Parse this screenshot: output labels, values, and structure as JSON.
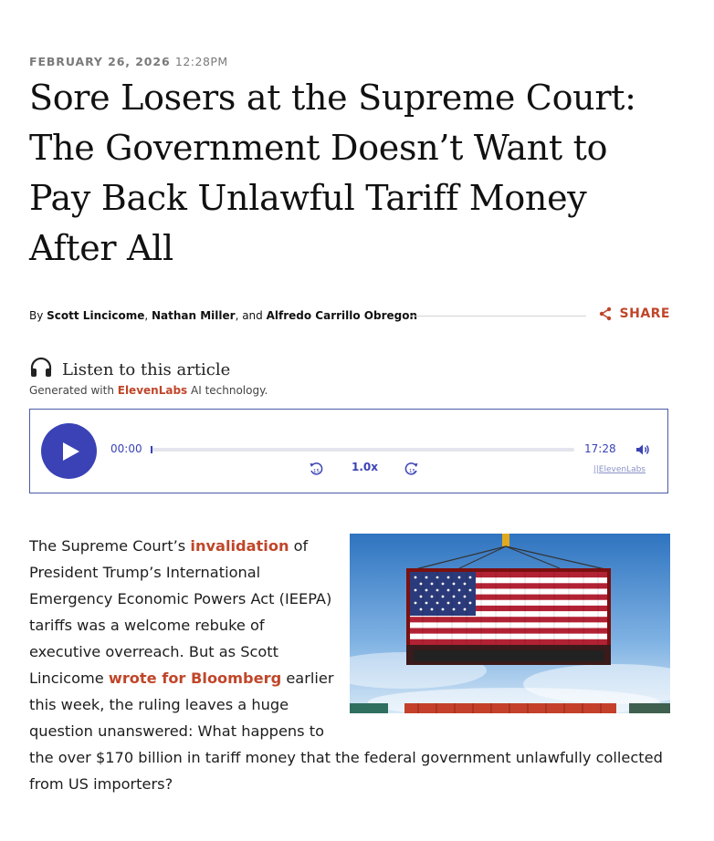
{
  "article": {
    "date": "FEBRUARY 26, 2026",
    "time": "12:28PM",
    "title": "Sore Losers at the Supreme Court: The Government Doesn’t Want to Pay Back Unlawful Tariff Money After All",
    "byline": {
      "prefix": "By ",
      "authors": [
        "Scott Lincicome",
        "Nathan Miller",
        "Alfredo Carrillo Obregon"
      ],
      "sep1": ", ",
      "sep2": ", and "
    },
    "share_label": "SHARE"
  },
  "audio": {
    "listen_label": "Listen to this article",
    "generated_prefix": "Generated with ",
    "generated_brand": "ElevenLabs",
    "generated_suffix": " AI technology.",
    "current_time": "00:00",
    "total_time": "17:28",
    "speed": "1.0x",
    "credit": "||ElevenLabs",
    "progress": 0,
    "accent_color": "#3a42b5"
  },
  "body": {
    "p1_before": "The Supreme Court’s ",
    "link1": "invalidation",
    "p1_mid": " of President Trump’s International Emergency Economic Powers Act (IEEPA) tariffs was a welcome rebuke of executive overreach. But as Scott Lincicome ",
    "link2": "wrote for Bloomberg",
    "p1_after": " earlier this week, the ruling leaves a huge question unanswered: What happens to the over $170 billion in tariff money that the federal government unlawfully collected from US importers?"
  },
  "icons": {
    "share": "share-icon",
    "headphones": "headphones-icon",
    "play": "play-icon",
    "volume": "volume-icon",
    "rewind": "rewind-15-icon",
    "forward": "forward-15-icon"
  },
  "colors": {
    "accent": "#c0462a",
    "player": "#3a42b5"
  }
}
